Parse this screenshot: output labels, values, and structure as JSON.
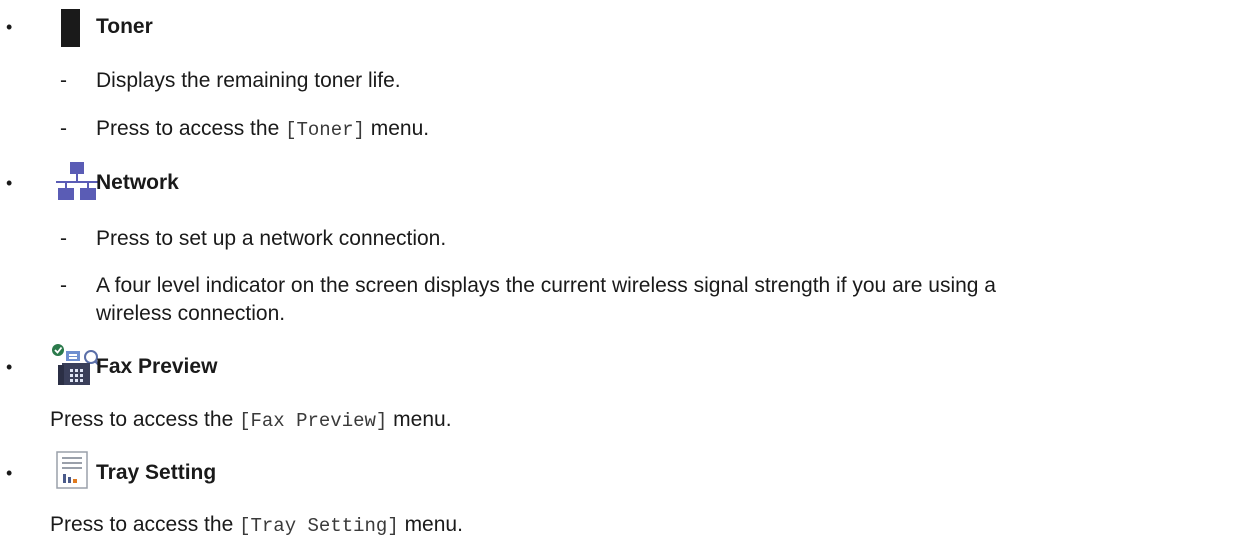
{
  "items": [
    {
      "title": "Toner",
      "icon": "toner-icon",
      "sub": [
        {
          "text": "Displays the remaining toner life."
        },
        {
          "before": "Press to access the ",
          "code": "[Toner]",
          "after": " menu."
        }
      ]
    },
    {
      "title": "Network",
      "icon": "network-icon",
      "icon_color": "#5a5cb5",
      "sub": [
        {
          "text": "Press to set up a network connection."
        },
        {
          "text_line1": "A four level indicator on the screen displays the current wireless signal strength if you are using a",
          "text_line2": "wireless connection."
        }
      ]
    },
    {
      "title": "Fax Preview",
      "icon": "fax-preview-icon",
      "before": "Press to access the ",
      "code": "[Fax Preview]",
      "after": " menu."
    },
    {
      "title": "Tray Setting",
      "icon": "tray-setting-icon",
      "before": "Press to access the ",
      "code": "[Tray Setting]",
      "after": " menu."
    }
  ],
  "bullet_char": "•",
  "dash_char": "-"
}
